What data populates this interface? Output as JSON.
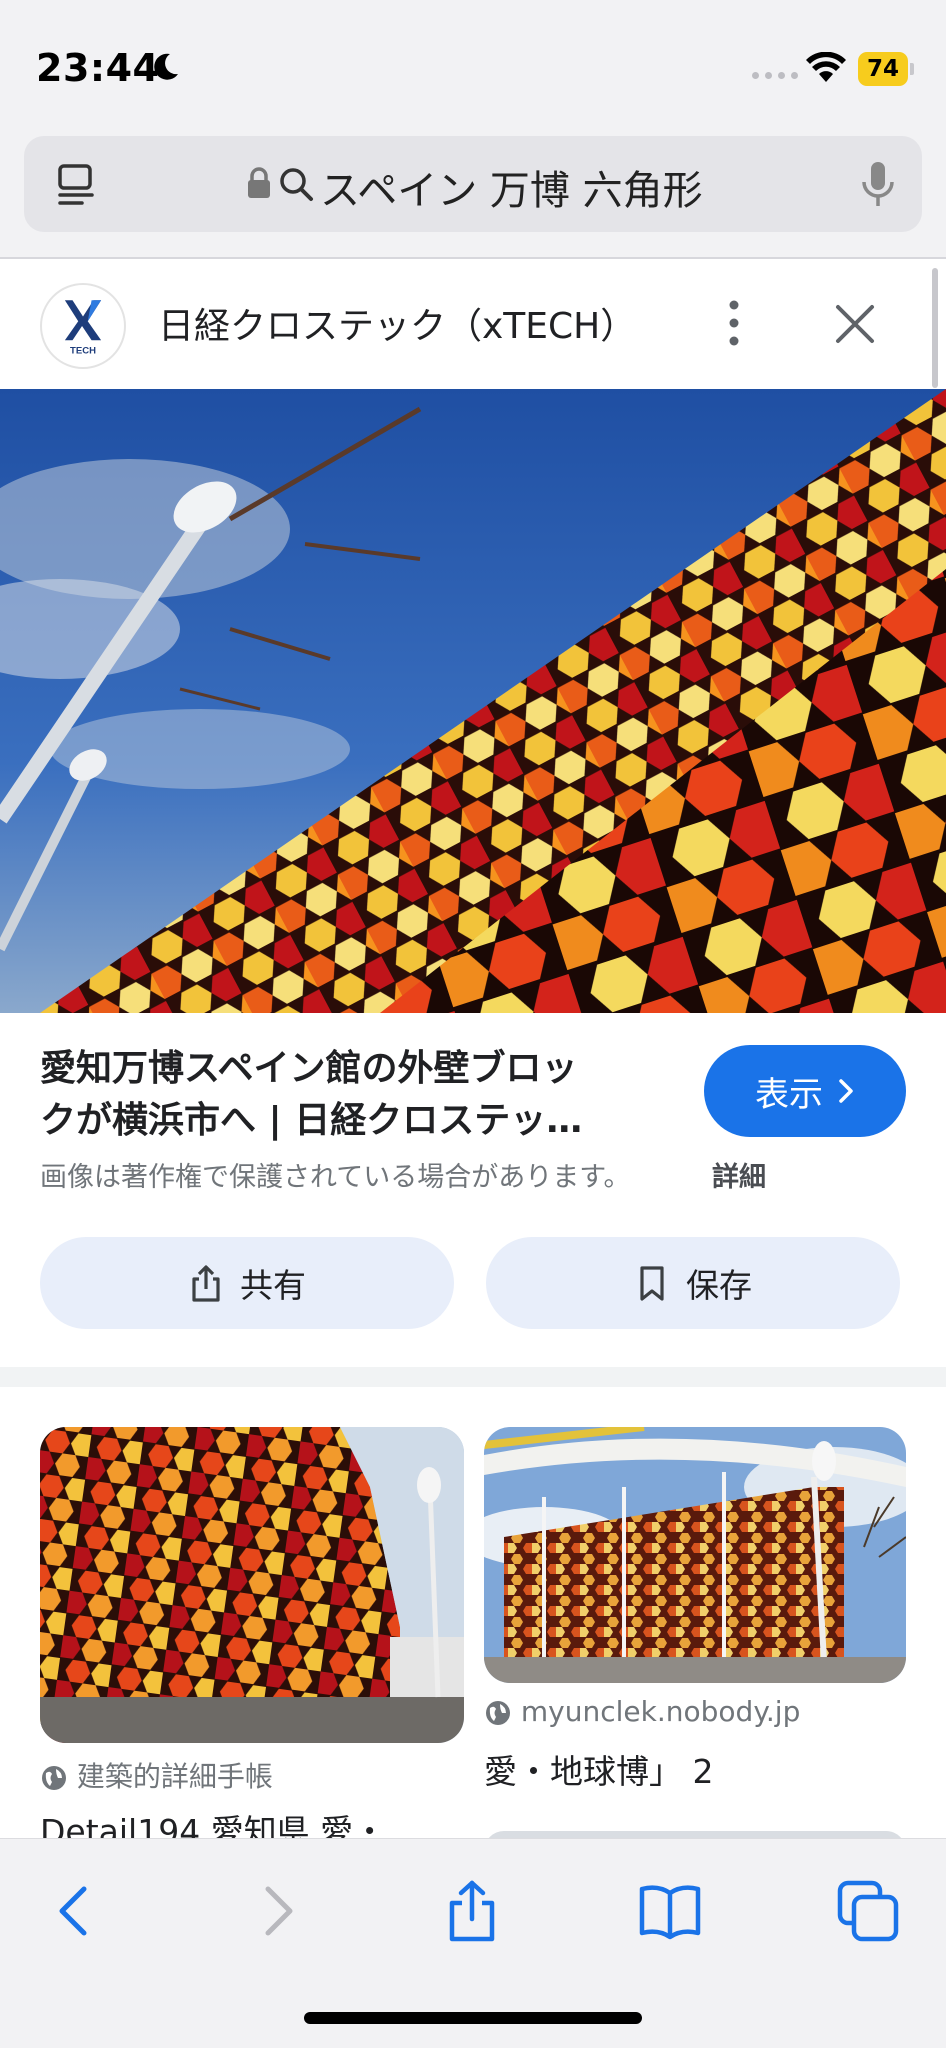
{
  "status_bar": {
    "time": "23:44",
    "battery": "74"
  },
  "address_bar": {
    "query": "スペイン 万博 六角形"
  },
  "source": {
    "logo_text": "TECH",
    "name": "日経クロステック（xTECH）"
  },
  "result": {
    "title_line1": "愛知万博スペイン館の外壁ブロッ",
    "title_line2": "クが横浜市へ | 日経クロステッ…",
    "view_label": "表示",
    "copyright": "画像は著作権で保護されている場合があります。",
    "details": "詳細",
    "share_label": "共有",
    "save_label": "保存"
  },
  "related": [
    {
      "site": "建築的詳細手帳",
      "title": "Detail194 愛知県 愛・…"
    },
    {
      "site": "myunclek.nobody.jp",
      "title": "愛・地球博」 2"
    }
  ],
  "colors": {
    "accent": "#1a73e8",
    "chip_bg": "#e8eefa",
    "battery": "#f7cc1d"
  }
}
